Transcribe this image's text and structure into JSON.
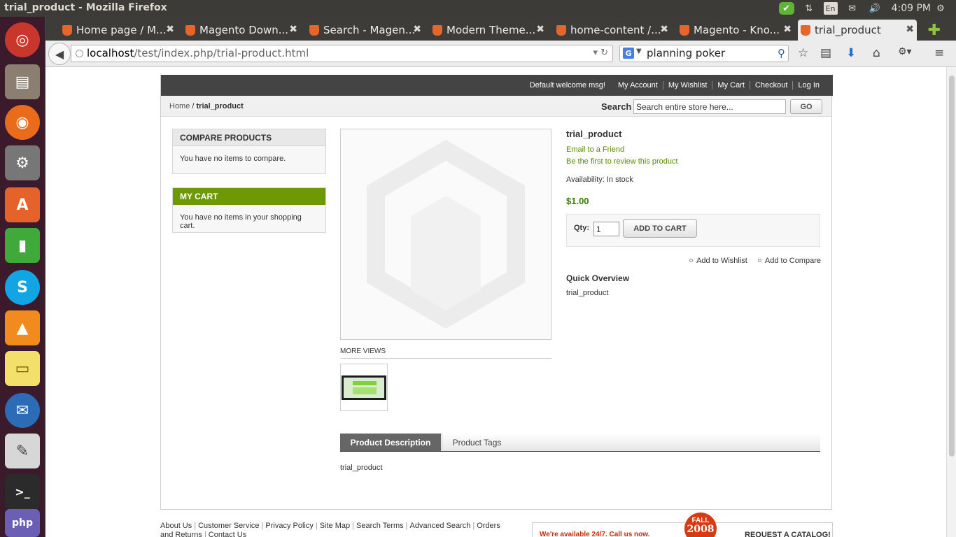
{
  "window": {
    "title": "trial_product - Mozilla Firefox"
  },
  "tray": {
    "keyboard": "En",
    "clock": "4:09 PM"
  },
  "launcher": [
    {
      "name": "ubuntu-dash-icon"
    },
    {
      "name": "files-icon"
    },
    {
      "name": "firefox-icon"
    },
    {
      "name": "system-settings-icon"
    },
    {
      "name": "software-center-icon"
    },
    {
      "name": "green-pipe-icon"
    },
    {
      "name": "skype-icon"
    },
    {
      "name": "vlc-icon"
    },
    {
      "name": "sticky-notes-icon"
    },
    {
      "name": "thunderbird-icon"
    },
    {
      "name": "text-editor-icon"
    },
    {
      "name": "terminal-icon"
    },
    {
      "name": "php-icon"
    }
  ],
  "tabs": [
    {
      "label": "Home page / M...",
      "close": "✖"
    },
    {
      "label": "Magento Down...",
      "close": "✖"
    },
    {
      "label": "Search - Magen...",
      "close": "✖"
    },
    {
      "label": "Modern Theme...",
      "close": "✖"
    },
    {
      "label": "home-content /...",
      "close": "✖"
    },
    {
      "label": "Magento - Kno...",
      "close": "✖"
    },
    {
      "label": "trial_product",
      "close": "✖"
    }
  ],
  "nav": {
    "url_host": "localhost",
    "url_path": "/test/index.php/trial-product.html",
    "search_value": "planning poker"
  },
  "store": {
    "welcome": "Default welcome msg!",
    "header_links": [
      "My Account",
      "My Wishlist",
      "My Cart",
      "Checkout",
      "Log In"
    ],
    "breadcrumb_home": "Home",
    "breadcrumb_sep": " / ",
    "breadcrumb_current": "trial_product",
    "search_label": "Search",
    "search_placeholder": "Search entire store here...",
    "search_button": "GO"
  },
  "sidebar": {
    "compare_title": "COMPARE PRODUCTS",
    "compare_text": "You have no items to compare.",
    "cart_title": "MY CART",
    "cart_text": "You have no items in your shopping cart."
  },
  "product": {
    "name": "trial_product",
    "email_friend": "Email to a Friend",
    "review": "Be the first to review this product",
    "availability": "Availability: In stock",
    "price": "$1.00",
    "qty_label": "Qty:",
    "qty_value": "1",
    "add_to_cart": "ADD TO CART",
    "add_wishlist": "Add to Wishlist",
    "add_compare": "Add to Compare",
    "quick_overview_title": "Quick Overview",
    "quick_overview_text": "trial_product",
    "more_views": "MORE VIEWS",
    "tab_description": "Product Description",
    "tab_tags": "Product Tags",
    "description": "trial_product"
  },
  "footer": {
    "links": [
      "About Us",
      "Customer Service",
      "Privacy Policy",
      "Site Map",
      "Search Terms",
      "Advanced Search",
      "Orders",
      "and Returns",
      "Contact Us"
    ],
    "banner_available": "We're available 24/7. Call us now.",
    "banner_fall": "FALL",
    "banner_year": "2008",
    "banner_request": "REQUEST A CATALOG!"
  },
  "colors": {
    "accent_green": "#6d9a04",
    "price_green": "#3a7e00",
    "header_dark": "#444444",
    "ubuntu_panel": "#3c3b37"
  }
}
